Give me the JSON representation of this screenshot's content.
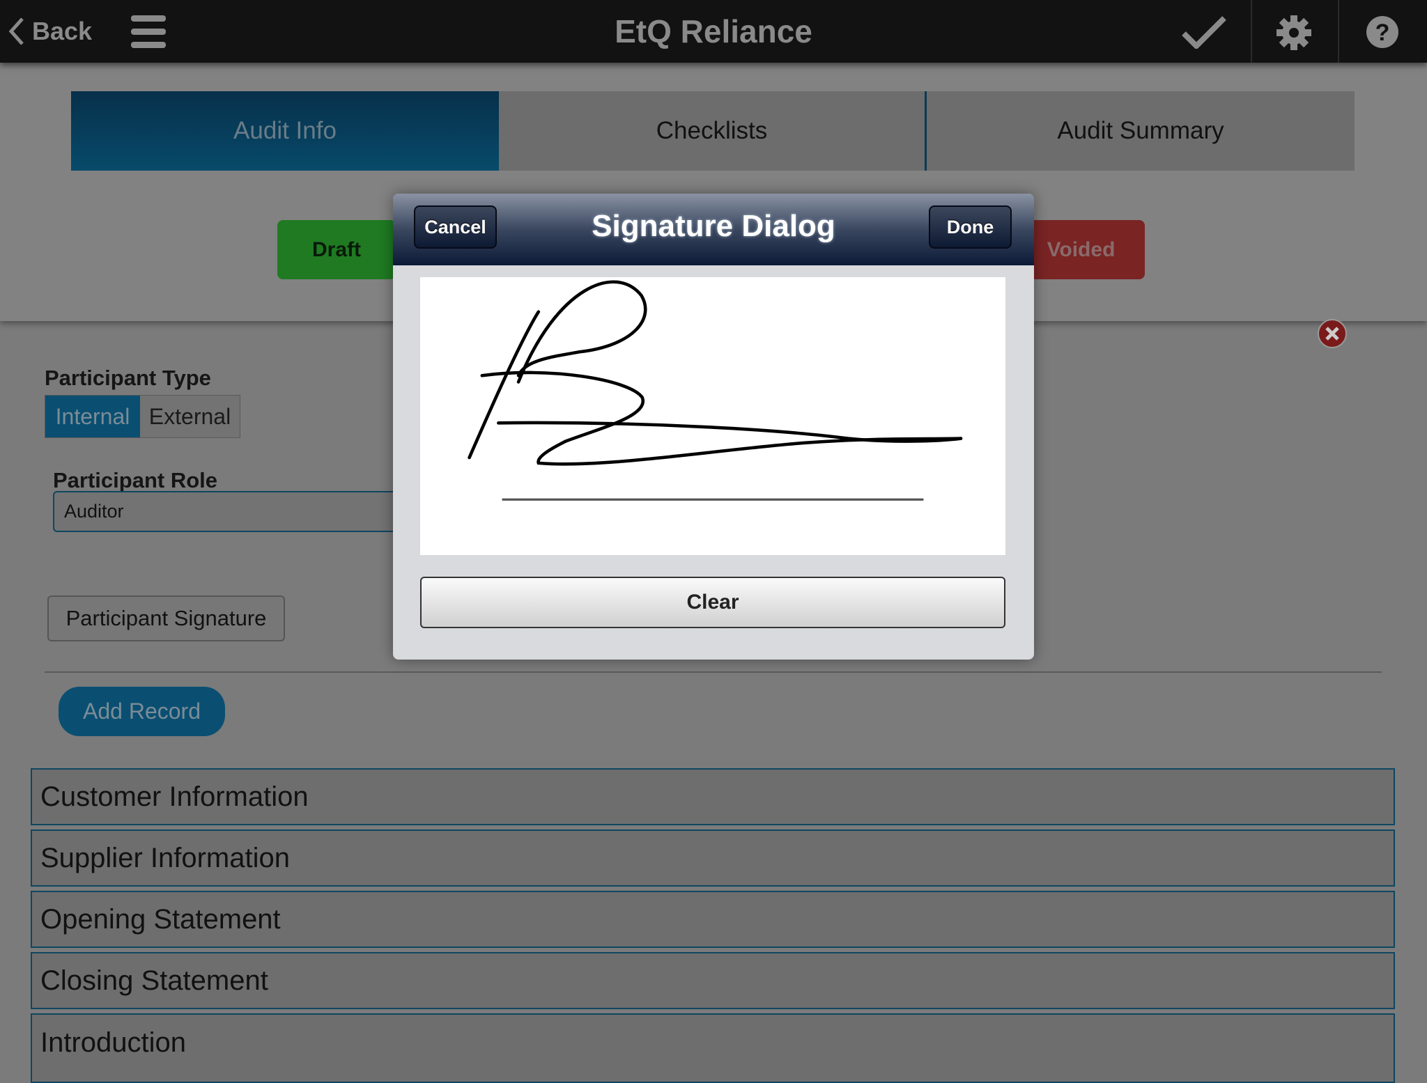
{
  "header": {
    "back_label": "Back",
    "title": "EtQ Reliance",
    "icons": [
      "chevron-left-icon",
      "menu-icon",
      "check-icon",
      "gear-icon",
      "help-icon"
    ]
  },
  "tabs": [
    {
      "label": "Audit Info",
      "active": true
    },
    {
      "label": "Checklists"
    },
    {
      "label": "Audit Summary"
    }
  ],
  "workflow": {
    "draft": "Draft",
    "voided": "Voided"
  },
  "form": {
    "participant_type_label": "Participant Type",
    "participant_type_options": [
      "Internal",
      "External"
    ],
    "participant_type_selected": "Internal",
    "participant_role_label": "Participant Role",
    "participant_role_value": "Auditor",
    "signature_button": "Participant Signature",
    "add_record": "Add Record"
  },
  "sections": [
    "Customer Information",
    "Supplier Information",
    "Opening Statement",
    "Closing Statement",
    "Introduction"
  ],
  "dialog": {
    "title": "Signature Dialog",
    "cancel": "Cancel",
    "done": "Done",
    "clear": "Clear"
  },
  "colors": {
    "accent": "#0a5a80",
    "draft": "#1f7a22",
    "voided": "#7a2424",
    "header": "#121212"
  }
}
